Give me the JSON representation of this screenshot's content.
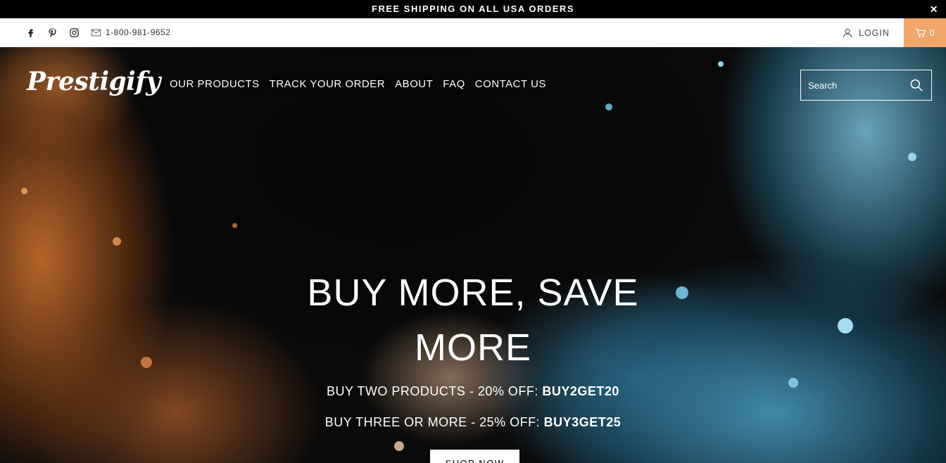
{
  "announcement": {
    "text": "FREE SHIPPING ON ALL USA ORDERS",
    "close": "✕"
  },
  "utility": {
    "social_icons": [
      "facebook-icon",
      "pinterest-icon",
      "instagram-icon",
      "mail-icon"
    ],
    "phone": "1-800-981-9652",
    "login_label": "LOGIN",
    "cart_count": "0"
  },
  "header": {
    "logo": "Prestigify",
    "nav": [
      "OUR PRODUCTS",
      "TRACK YOUR ORDER",
      "ABOUT",
      "FAQ",
      "CONTACT US"
    ],
    "search_placeholder": "Search"
  },
  "hero": {
    "headline": "BUY MORE, SAVE MORE",
    "promo1_text": "BUY TWO PRODUCTS - 20% OFF: ",
    "promo1_code": "BUY2GET20",
    "promo2_text": "BUY THREE OR MORE - 25% OFF: ",
    "promo2_code": "BUY3GET25",
    "cta": "SHOP NOW"
  },
  "colors": {
    "accent": "#f0a56a",
    "announce_bg": "#000000"
  }
}
